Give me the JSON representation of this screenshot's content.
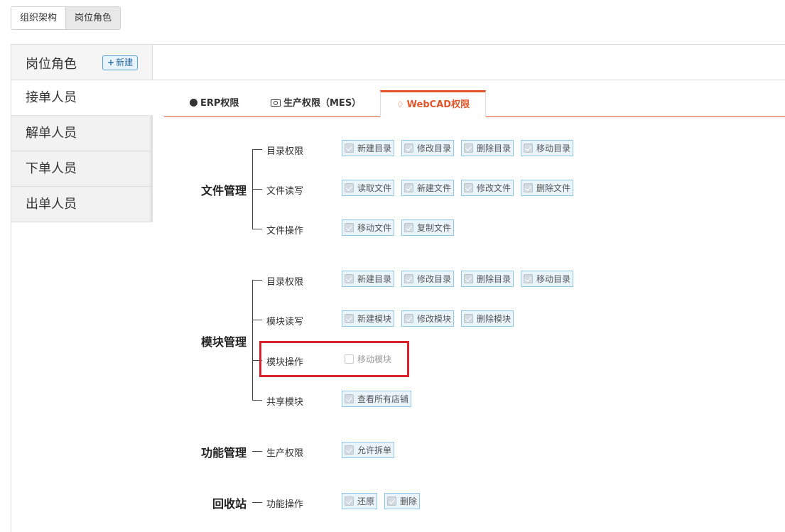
{
  "top_tabs": [
    {
      "label": "组织架构",
      "active": false
    },
    {
      "label": "岗位角色",
      "active": true
    }
  ],
  "sidebar": {
    "title": "岗位角色",
    "add_label": "新建",
    "items": [
      {
        "label": "接单人员",
        "active": true
      },
      {
        "label": "解单人员",
        "active": false
      },
      {
        "label": "下单人员",
        "active": false
      },
      {
        "label": "出单人员",
        "active": false
      }
    ]
  },
  "perm_tabs": [
    {
      "label": "ERP权限",
      "icon": "globe-icon",
      "active": false
    },
    {
      "label": "生产权限（MES）",
      "icon": "camera-icon",
      "active": false
    },
    {
      "label": "WebCAD权限",
      "icon": "cad-icon",
      "active": true
    }
  ],
  "groups": [
    {
      "label": "文件管理",
      "rows": [
        {
          "label": "目录权限",
          "options": [
            {
              "label": "新建目录",
              "checked": true
            },
            {
              "label": "修改目录",
              "checked": true
            },
            {
              "label": "删除目录",
              "checked": true
            },
            {
              "label": "移动目录",
              "checked": true
            }
          ]
        },
        {
          "label": "文件读写",
          "options": [
            {
              "label": "读取文件",
              "checked": true
            },
            {
              "label": "新建文件",
              "checked": true
            },
            {
              "label": "修改文件",
              "checked": true
            },
            {
              "label": "删除文件",
              "checked": true
            }
          ]
        },
        {
          "label": "文件操作",
          "options": [
            {
              "label": "移动文件",
              "checked": true
            },
            {
              "label": "复制文件",
              "checked": true
            }
          ]
        }
      ]
    },
    {
      "label": "模块管理",
      "rows": [
        {
          "label": "目录权限",
          "options": [
            {
              "label": "新建目录",
              "checked": true
            },
            {
              "label": "修改目录",
              "checked": true
            },
            {
              "label": "删除目录",
              "checked": true
            },
            {
              "label": "移动目录",
              "checked": true
            }
          ]
        },
        {
          "label": "模块读写",
          "options": [
            {
              "label": "新建模块",
              "checked": true
            },
            {
              "label": "修改模块",
              "checked": true
            },
            {
              "label": "删除模块",
              "checked": true
            }
          ]
        },
        {
          "label": "模块操作",
          "options": [
            {
              "label": "移动模块",
              "checked": false
            }
          ]
        },
        {
          "label": "共享模块",
          "options": [
            {
              "label": "查看所有店铺",
              "checked": true
            }
          ]
        }
      ]
    },
    {
      "label": "功能管理",
      "rows": [
        {
          "label": "生产权限",
          "options": [
            {
              "label": "允许拆单",
              "checked": true
            }
          ]
        }
      ]
    },
    {
      "label": "回收站",
      "rows": [
        {
          "label": "功能操作",
          "options": [
            {
              "label": "还原",
              "checked": true
            },
            {
              "label": "删除",
              "checked": true
            }
          ]
        }
      ]
    }
  ],
  "colors": {
    "accent": "#e2552a",
    "highlight": "#d9232b",
    "check_border": "#8fc7e6"
  }
}
